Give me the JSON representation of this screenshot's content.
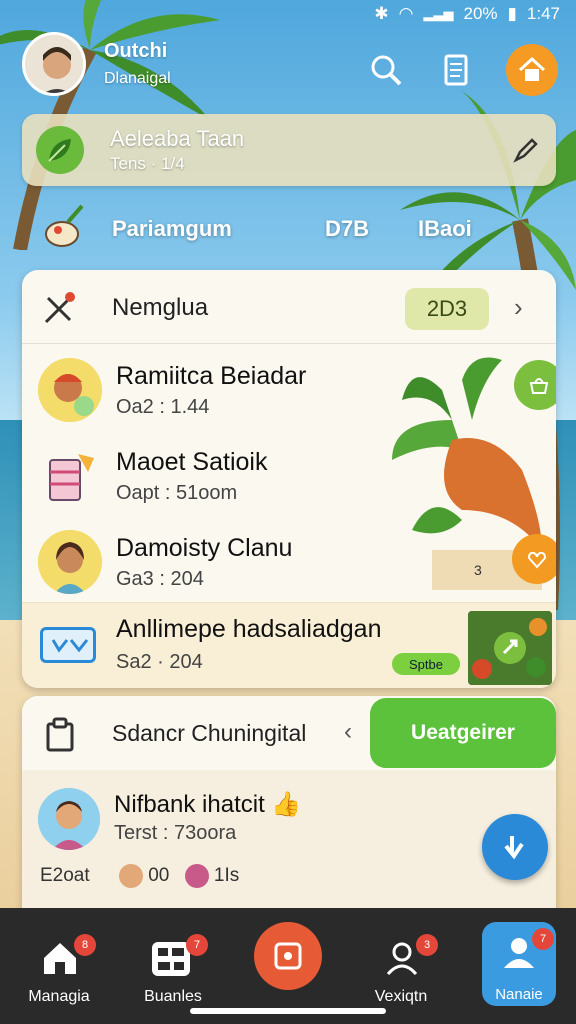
{
  "status_bar": {
    "battery": "20%",
    "time": "1:47"
  },
  "header": {
    "name": "Outchi",
    "subtitle": "Dlanaigal"
  },
  "banner": {
    "title": "Aeleaba Taan",
    "subtitle": "Tens · 1/4"
  },
  "stats": {
    "title": "Pariamgum",
    "number": "D7B",
    "extra": "IBaoi"
  },
  "list_card": {
    "title": "Nemglua",
    "badge": "2D3",
    "items": [
      {
        "title": "Ramiitca Beiadar",
        "sub": "Oa2 : 1.44"
      },
      {
        "title": "Maoet Satioik",
        "sub": "Oapt : 51oom"
      },
      {
        "title": "Damoisty Clanu",
        "sub": "Ga3 : 204"
      },
      {
        "title": "Anllimepe hadsaliadgan",
        "sub": "Sa2 · 204",
        "tag": "Sptbe"
      }
    ],
    "veg_number": "3"
  },
  "section2": {
    "title": "Sdancr Chuningital",
    "button_label": "Ueatgeirer",
    "person_name": "Nifbank ihatcit",
    "person_sub": "Terst : 73oora",
    "footer_label": "E2oat",
    "footer_count": "00",
    "footer_extra": "1Is"
  },
  "nav": {
    "items": [
      {
        "label": "Managia",
        "badge": "8"
      },
      {
        "label": "Buanles",
        "badge": "7"
      },
      {
        "label": "Vexiqtn",
        "badge": "3"
      },
      {
        "label": "Nanaie",
        "badge": "7"
      }
    ]
  },
  "colors": {
    "accent_orange": "#f59a22",
    "accent_green": "#5cc23c",
    "nav_bg": "#2a2a2a",
    "nav_active": "#3a9be0",
    "record_button": "#e65a36",
    "badge_red": "#e4473a"
  }
}
